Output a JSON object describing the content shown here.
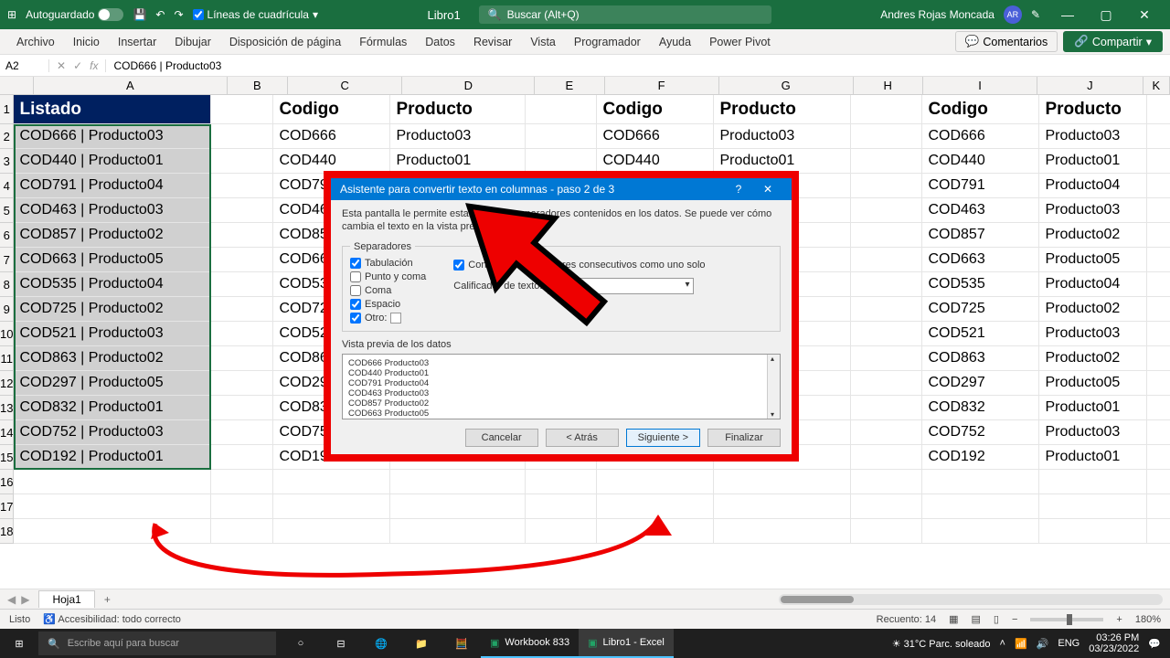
{
  "titlebar": {
    "autosave_label": "Autoguardado",
    "gridlines_label": "Líneas de cuadrícula",
    "doc_name": "Libro1",
    "search_placeholder": "Buscar (Alt+Q)",
    "user_name": "Andres Rojas Moncada"
  },
  "ribbon": {
    "tabs": [
      "Archivo",
      "Inicio",
      "Insertar",
      "Dibujar",
      "Disposición de página",
      "Fórmulas",
      "Datos",
      "Revisar",
      "Vista",
      "Programador",
      "Ayuda",
      "Power Pivot"
    ],
    "comments": "Comentarios",
    "share": "Compartir"
  },
  "formula_bar": {
    "name_box": "A2",
    "formula": "COD666 | Producto03"
  },
  "columns": [
    "A",
    "B",
    "C",
    "D",
    "E",
    "F",
    "G",
    "H",
    "I",
    "J",
    "K"
  ],
  "header_row": {
    "A": "Listado",
    "C": "Codigo",
    "D": "Producto",
    "F": "Codigo",
    "G": "Producto",
    "I": "Codigo",
    "J": "Producto"
  },
  "listado": [
    "COD666 | Producto03",
    "COD440 | Producto01",
    "COD791 | Producto04",
    "COD463 | Producto03",
    "COD857 | Producto02",
    "COD663 | Producto05",
    "COD535 | Producto04",
    "COD725 | Producto02",
    "COD521 | Producto03",
    "COD863 | Producto02",
    "COD297 | Producto05",
    "COD832 | Producto01",
    "COD752 | Producto03",
    "COD192 | Producto01"
  ],
  "codigos": [
    "COD666",
    "COD440",
    "COD791",
    "COD463",
    "COD857",
    "COD663",
    "COD535",
    "COD725",
    "COD521",
    "COD863",
    "COD297",
    "COD832",
    "COD752",
    "COD192"
  ],
  "productos": [
    "Producto03",
    "Producto01",
    "Producto04",
    "Producto03",
    "Producto02",
    "Producto05",
    "Producto04",
    "Producto02",
    "Producto03",
    "Producto02",
    "Producto05",
    "Producto01",
    "Producto03",
    "Producto01"
  ],
  "sheet_tab": "Hoja1",
  "statusbar": {
    "ready": "Listo",
    "accessibility": "Accesibilidad: todo correcto",
    "count": "Recuento: 14",
    "zoom": "180%"
  },
  "dialog": {
    "title": "Asistente para convertir texto en columnas - paso 2 de 3",
    "desc": "Esta pantalla le permite establecer los separadores contenidos en los datos. Se puede ver cómo cambia el texto en la vista previa.",
    "separators_legend": "Separadores",
    "sep_tab": "Tabulación",
    "sep_semicolon": "Punto y coma",
    "sep_comma": "Coma",
    "sep_space": "Espacio",
    "sep_other": "Otro:",
    "consec": "Considerar separadores consecutivos como uno solo",
    "qualifier_label": "Calificador de texto:",
    "preview_label": "Vista previa de los datos",
    "preview_lines": [
      "COD666 Producto03",
      "COD440 Producto01",
      "COD791 Producto04",
      "COD463 Producto03",
      "COD857 Producto02",
      "COD663 Producto05"
    ],
    "btn_cancel": "Cancelar",
    "btn_back": "< Atrás",
    "btn_next": "Siguiente >",
    "btn_finish": "Finalizar"
  },
  "taskbar": {
    "search_placeholder": "Escribe aquí para buscar",
    "app1": "Workbook 833",
    "app2": "Libro1 - Excel",
    "weather": "31°C  Parc. soleado",
    "lang": "ENG",
    "time": "03:26 PM",
    "date": "03/23/2022"
  }
}
